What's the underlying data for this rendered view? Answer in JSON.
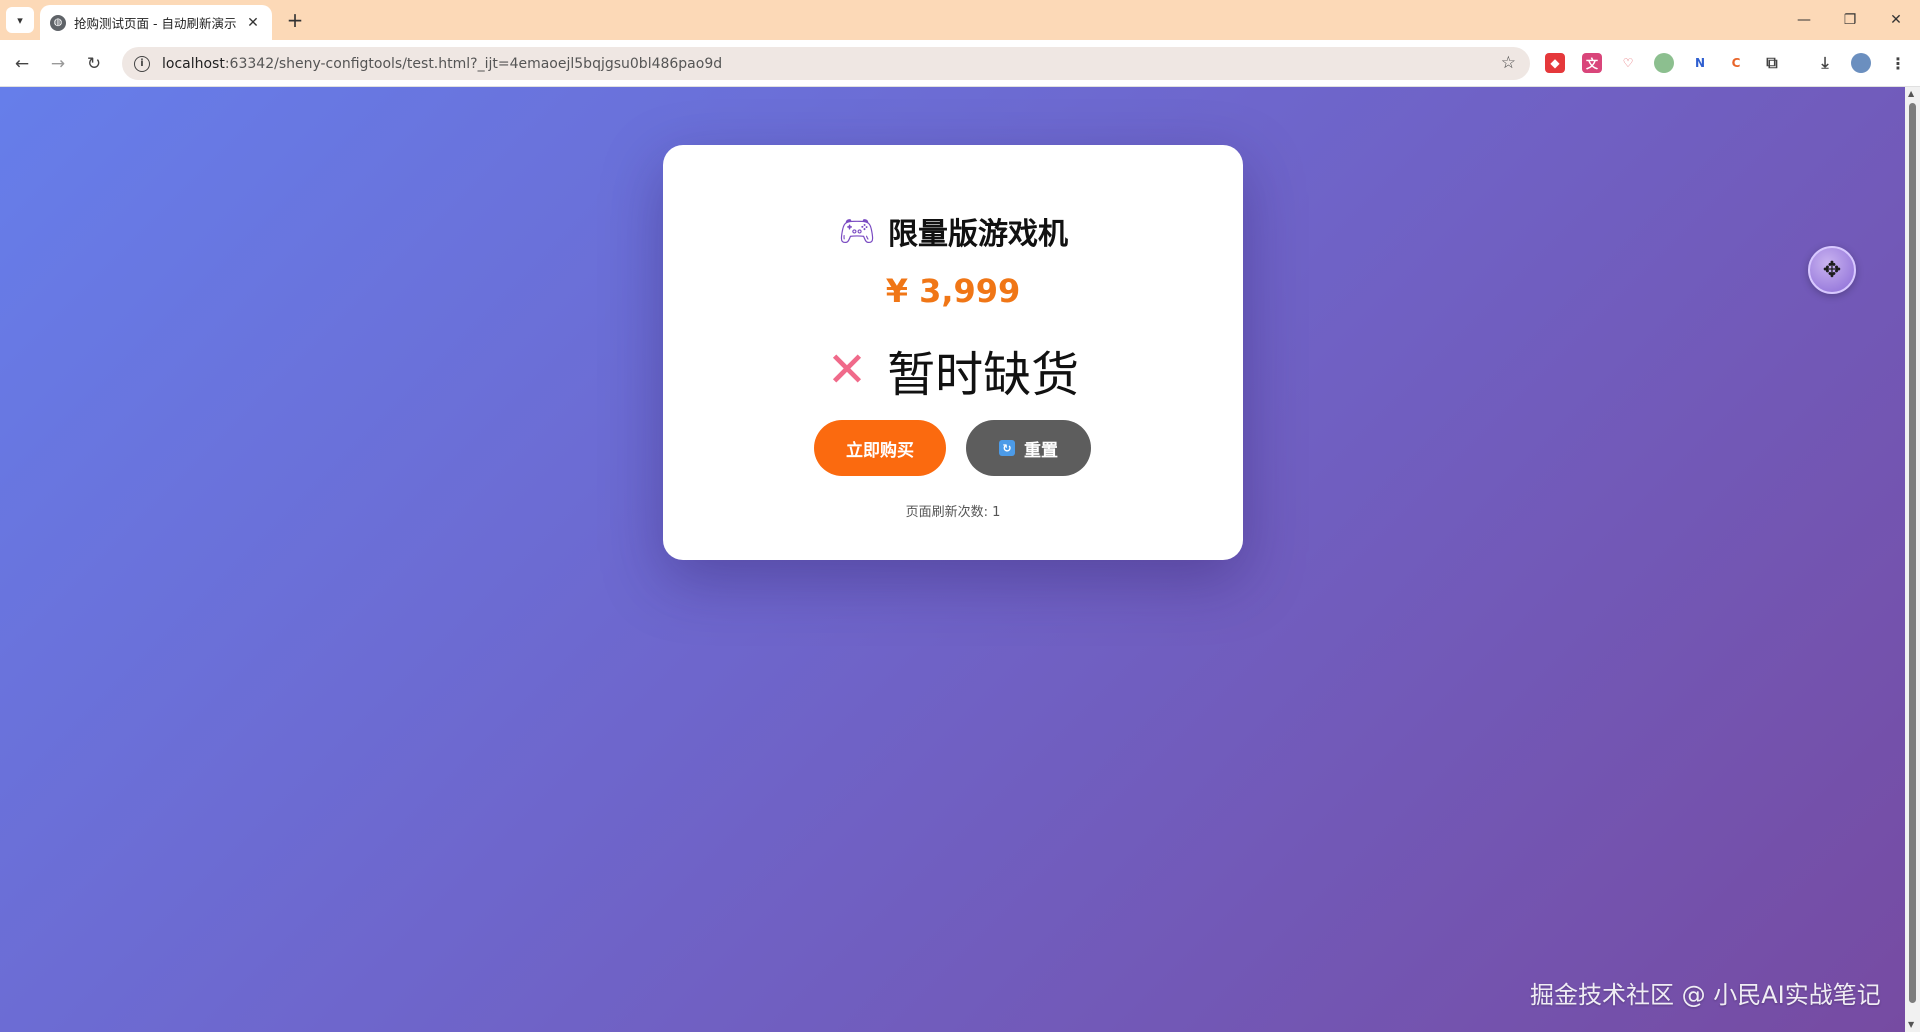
{
  "browser": {
    "tab_title": "抢购测试页面 - 自动刷新演示",
    "url_host": "localhost",
    "url_rest": ":63342/sheny-configtools/test.html?_ijt=4emaoejl5bqjgsu0bl486pao9d"
  },
  "product": {
    "icon": "gamepad-icon",
    "name": "限量版游戏机",
    "price": "¥ 3,999"
  },
  "status": {
    "icon": "cross-mark-icon",
    "text": "暂时缺货"
  },
  "buttons": {
    "buy_label": "立即购买",
    "reset_label": "重置"
  },
  "refresh_count_text": "页面刷新次数: 1",
  "watermark": "掘金技术社区 @ 小民AI实战笔记",
  "colors": {
    "accent_price": "#f07616",
    "buy_button": "#fb6a0f",
    "reset_button": "#5d5d5d",
    "background_gradient": [
      "#667eea",
      "#764ba2"
    ]
  }
}
